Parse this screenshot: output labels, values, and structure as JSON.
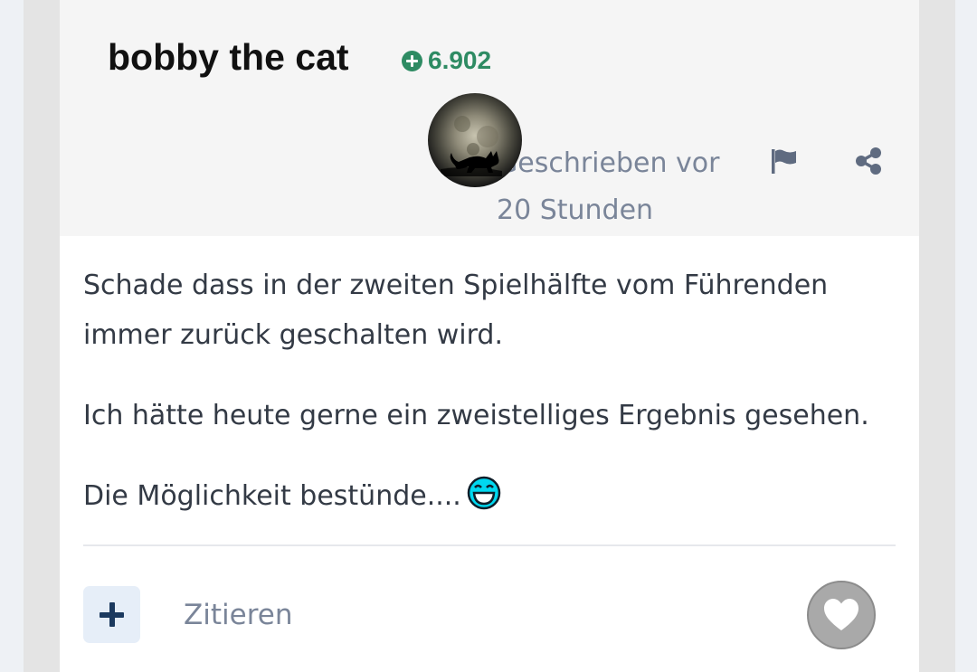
{
  "post": {
    "author": "bobby the cat",
    "reputation": "6.902",
    "posted_text": "Geschrieben vor 20 Stunden",
    "paragraphs": [
      "Schade dass in der zweiten Spielhälfte vom Führenden immer zurück geschalten wird.",
      "Ich hätte heute gerne ein zweistelliges Ergebnis gesehen.",
      "Die Möglichkeit bestünde...."
    ],
    "emoji_icon": "laughing-smiley-icon"
  },
  "actions": {
    "quote_label": "Zitieren",
    "report_icon": "flag-icon",
    "share_icon": "share-icon",
    "multiquote_icon": "plus-icon",
    "like_icon": "heart-icon"
  },
  "colors": {
    "reputation": "#2e8b63",
    "muted_text": "#7a8599",
    "body_text": "#333a45",
    "header_bg": "#f5f5f5",
    "plus_button_bg": "#e6eef8",
    "plus_icon": "#1c3a5f",
    "like_button": "#a9a9a9",
    "smiley": "#00d8f0"
  }
}
